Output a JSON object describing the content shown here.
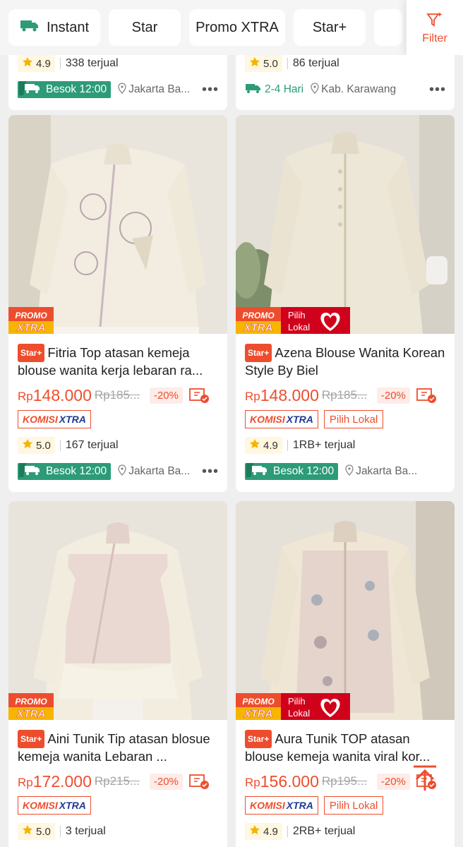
{
  "filters": {
    "chips": [
      "Instant",
      "Star",
      "Promo XTRA",
      "Star+"
    ],
    "filter_label": "Filter"
  },
  "partial_cards": [
    {
      "rating": "4.9",
      "sold": "338 terjual",
      "shipping": "Besok 12:00",
      "location": "Jakarta Ba..."
    },
    {
      "rating": "5.0",
      "sold": "86 terjual",
      "shipping": "2-4 Hari",
      "location": "Kab. Karawang"
    }
  ],
  "products": [
    {
      "tag": "Star+",
      "title": "Fitria Top atasan kemeja blouse wanita kerja lebaran ra...",
      "price_currency": "Rp",
      "price": "148.000",
      "old_price": "Rp185...",
      "discount": "-20%",
      "komisi_label": "KOMISI",
      "komisi_x": "XTRA",
      "rating": "5.0",
      "sold": "167 terjual",
      "shipping": "Besok 12:00",
      "location": "Jakarta Ba..."
    },
    {
      "tag": "Star+",
      "title": "Azena Blouse Wanita Korean Style By Biel",
      "price_currency": "Rp",
      "price": "148.000",
      "old_price": "Rp185...",
      "discount": "-20%",
      "komisi_label": "KOMISI",
      "komisi_x": "XTRA",
      "lokal_label": "Pilih Lokal",
      "rating": "4.9",
      "sold": "1RB+ terjual",
      "shipping": "Besok 12:00",
      "location": "Jakarta Ba..."
    },
    {
      "tag": "Star+",
      "title": "Aini Tunik Tip atasan blosue kemeja wanita Lebaran ...",
      "price_currency": "Rp",
      "price": "172.000",
      "old_price": "Rp215...",
      "discount": "-20%",
      "komisi_label": "KOMISI",
      "komisi_x": "XTRA",
      "rating": "5.0",
      "sold": "3 terjual"
    },
    {
      "tag": "Star+",
      "title": "Aura Tunik TOP atasan blouse kemeja wanita viral kor...",
      "price_currency": "Rp",
      "price": "156.000",
      "old_price": "Rp195...",
      "discount": "-20%",
      "komisi_label": "KOMISI",
      "komisi_x": "XTRA",
      "lokal_label": "Pilih Lokal",
      "rating": "4.9",
      "sold": "2RB+ terjual"
    }
  ],
  "badges": {
    "promo_line1": "PROMO",
    "promo_line2": "XTRA",
    "lokal_line1": "Pilih",
    "lokal_line2": "Lokal"
  },
  "colors": {
    "accent": "#ee4d2d",
    "shipping_green": "#2d9b77",
    "komisi_blue": "#1f3a93"
  },
  "icons": [
    "truck-icon",
    "filter-icon",
    "star-icon",
    "location-pin-icon",
    "more-icon",
    "voucher-icon",
    "scroll-top-icon"
  ]
}
